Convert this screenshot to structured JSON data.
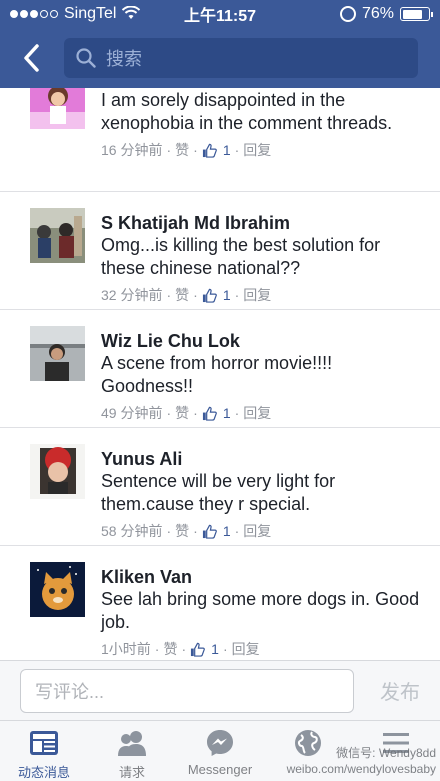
{
  "status_bar": {
    "carrier": "SingTel",
    "time": "上午11:57",
    "battery": "76%",
    "battery_level": 0.76
  },
  "header": {
    "search_placeholder": "搜索"
  },
  "comments": [
    {
      "author": "",
      "text": "I am sorely disappointed in the xenophobia in the comment threads.",
      "time": "16 分钟前",
      "like": "赞",
      "likes": "1",
      "reply": "回复"
    },
    {
      "author": "S Khatijah Md Ibrahim",
      "text": "Omg...is killing the best solution for these chinese national??",
      "time": "32 分钟前",
      "like": "赞",
      "likes": "1",
      "reply": "回复"
    },
    {
      "author": "Wiz Lie Chu Lok",
      "text": "A scene from horror movie!!!! Goodness!!",
      "time": "49 分钟前",
      "like": "赞",
      "likes": "1",
      "reply": "回复"
    },
    {
      "author": "Yunus Ali",
      "text": "Sentence will be very light for them.cause they r special.",
      "time": "58 分钟前",
      "like": "赞",
      "likes": "1",
      "reply": "回复"
    },
    {
      "author": "Kliken Van",
      "text": "See lah bring some more dogs in. Good job.",
      "time": "1小时前",
      "like": "赞",
      "likes": "1",
      "reply": "回复"
    }
  ],
  "composer": {
    "placeholder": "写评论...",
    "post_label": "发布"
  },
  "tabs": [
    {
      "label": "动态消息",
      "icon": "news-feed-icon"
    },
    {
      "label": "请求",
      "icon": "friend-requests-icon"
    },
    {
      "label": "Messenger",
      "icon": "messenger-icon"
    },
    {
      "label": "",
      "icon": "globe-icon"
    },
    {
      "label": "",
      "icon": "menu-icon"
    }
  ],
  "watermark": {
    "line1": "微信号: Wendy8dd",
    "line2": "weibo.com/wendylovesbaby"
  },
  "colors": {
    "brand": "#3b5998",
    "search_field": "#2d4a86",
    "meta_text": "#90949c"
  }
}
